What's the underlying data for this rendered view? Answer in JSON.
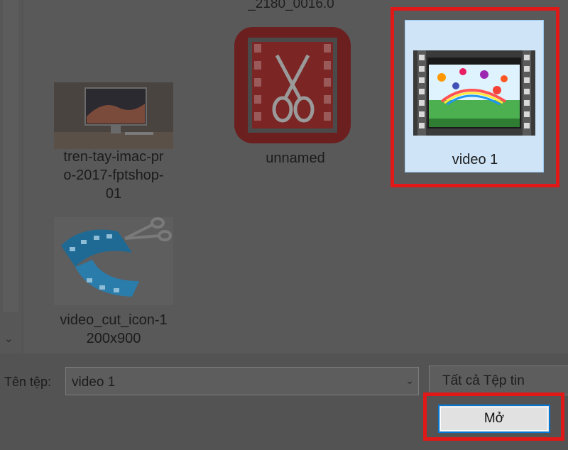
{
  "files": {
    "top_partial_name": "_2180_0016.0",
    "items": [
      {
        "name": "unnamed",
        "thumb": "video-cut-red-icon"
      },
      {
        "name": "video 1",
        "thumb": "video-film-thumbnail"
      },
      {
        "name": "tren-tay-imac-pro-2017-fptshop-01",
        "label_lines": "tren-tay-imac-pr\no-2017-fptshop-\n01",
        "thumb": "imac-photo"
      },
      {
        "name": "video_cut_icon-1200x900",
        "label_lines": "video_cut_icon-1\n200x900",
        "thumb": "video-cut-blue-icon"
      }
    ]
  },
  "footer": {
    "filename_label": "Tên tệp:",
    "filename_value": "video 1",
    "filter_value": "Tất cả Tệp tin",
    "open_button_label": "Mở"
  },
  "colors": {
    "highlight": "#e01818",
    "selection_bg": "#cfe5f7",
    "accent_border": "#0078d7"
  }
}
